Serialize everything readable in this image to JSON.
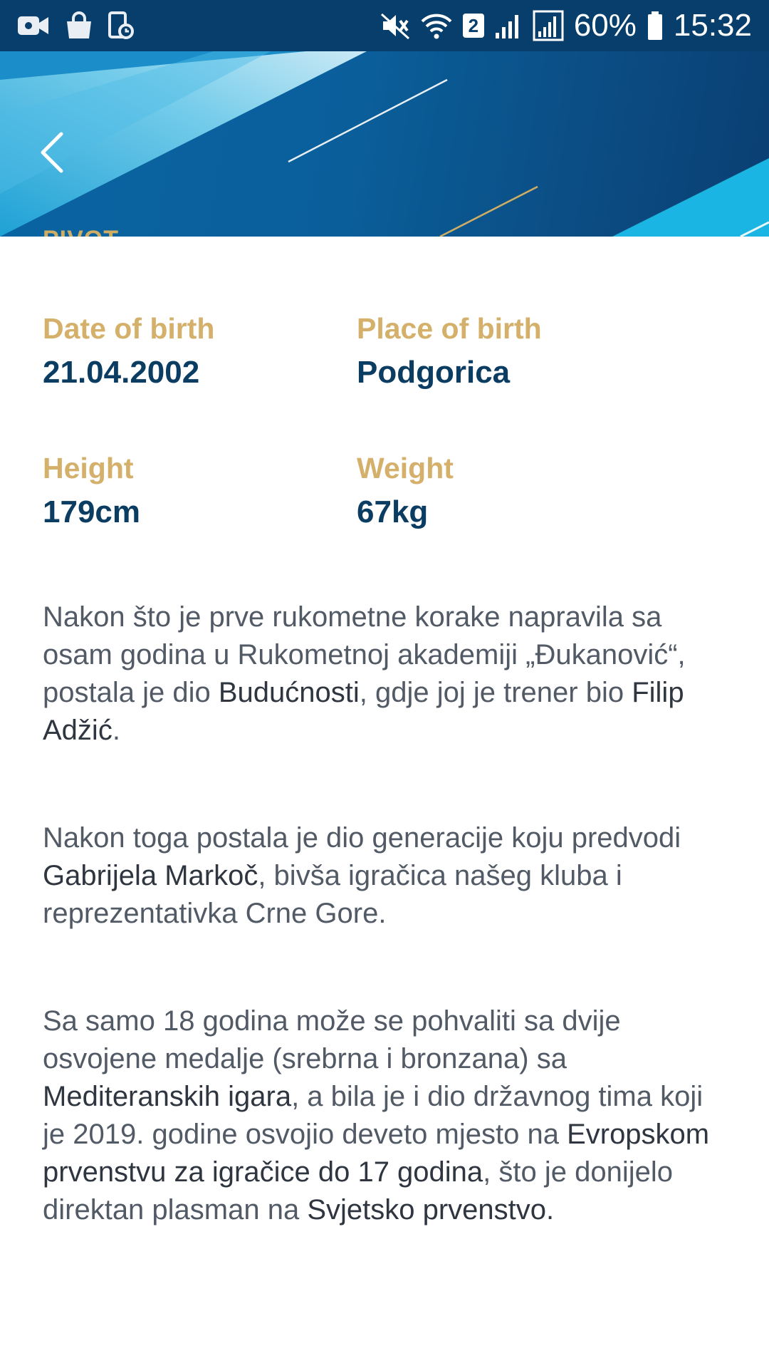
{
  "status_bar": {
    "battery": "60%",
    "time": "15:32",
    "sim_badge": "2",
    "icons": [
      "video-call-icon",
      "shopping-bag-icon",
      "screen-timer-icon",
      "mute-icon",
      "wifi-icon",
      "signal-icon",
      "signal-icon",
      "battery-icon"
    ]
  },
  "header": {
    "role_label": "PIVOT",
    "colors": {
      "accent_gold": "#cfae63",
      "banner_blue": "#0a5f9b",
      "text_navy": "#0b3c61"
    }
  },
  "stats": {
    "date_of_birth": {
      "label": "Date of birth",
      "value": "21.04.2002"
    },
    "place_of_birth": {
      "label": "Place of birth",
      "value": "Podgorica"
    },
    "height": {
      "label": "Height",
      "value": "179cm"
    },
    "weight": {
      "label": "Weight",
      "value": "67kg"
    }
  },
  "bio": [
    [
      {
        "t": "Nakon što je prve rukometne korake napravila sa osam godina u Rukometnoj akademiji „Đukanović“, postala je dio ",
        "b": false
      },
      {
        "t": "Budućnosti",
        "b": true
      },
      {
        "t": ", gdje joj je trener bio ",
        "b": false
      },
      {
        "t": "Filip Adžić",
        "b": true
      },
      {
        "t": ".",
        "b": false
      }
    ],
    [
      {
        "t": "Nakon toga postala je dio generacije koju predvodi ",
        "b": false
      },
      {
        "t": "Gabrijela Markoč",
        "b": true
      },
      {
        "t": ", bivša igračica našeg kluba i reprezentativka Crne Gore.",
        "b": false
      }
    ],
    [
      {
        "t": "Sa samo 18 godina može se pohvaliti sa dvije osvojene medalje (srebrna i bronzana) sa ",
        "b": false
      },
      {
        "t": "Mediteranskih igara",
        "b": true
      },
      {
        "t": ", a bila je i dio državnog tima koji je 2019. godine osvojio deveto mjesto na ",
        "b": false
      },
      {
        "t": "Evropskom prvenstvu za igračice do 17 godina",
        "b": true
      },
      {
        "t": ", što je donijelo direktan plasman na ",
        "b": false
      },
      {
        "t": "Svjetsko prvenstvo.",
        "b": true
      }
    ]
  ]
}
